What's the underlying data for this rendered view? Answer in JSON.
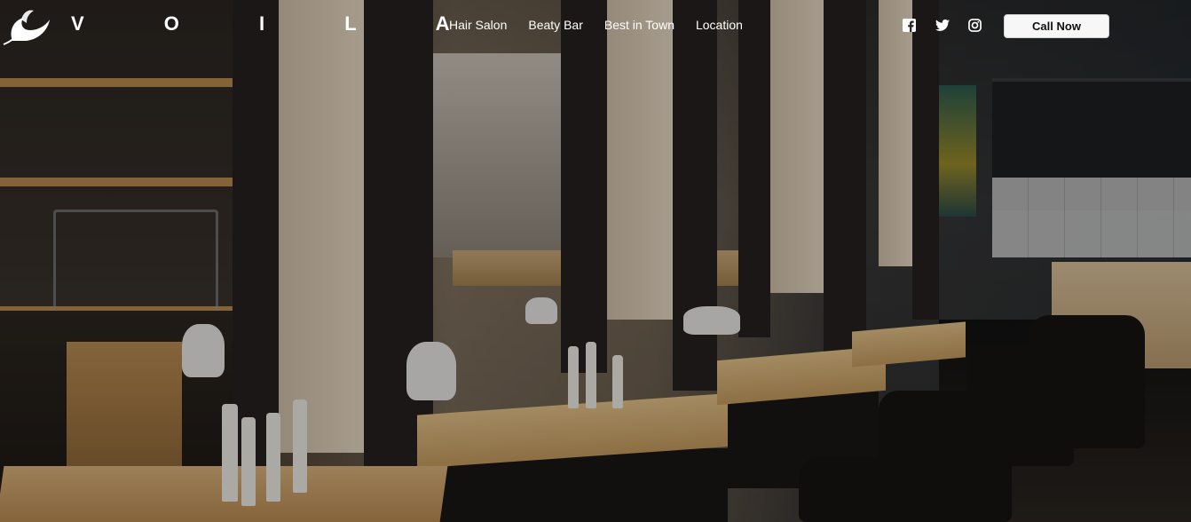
{
  "brand": {
    "name": "V O I L A",
    "logo_icon": "bird-logo-icon"
  },
  "nav": {
    "items": [
      {
        "label": "Hair Salon"
      },
      {
        "label": "Beaty Bar"
      },
      {
        "label": "Best in Town"
      },
      {
        "label": "Location"
      }
    ]
  },
  "social": [
    {
      "icon": "facebook-icon"
    },
    {
      "icon": "twitter-icon"
    },
    {
      "icon": "instagram-icon"
    }
  ],
  "cta": {
    "label": "Call Now"
  },
  "colors": {
    "nav_text": "#ffffff",
    "button_bg": "#f7f7f7",
    "button_text": "#111111"
  }
}
